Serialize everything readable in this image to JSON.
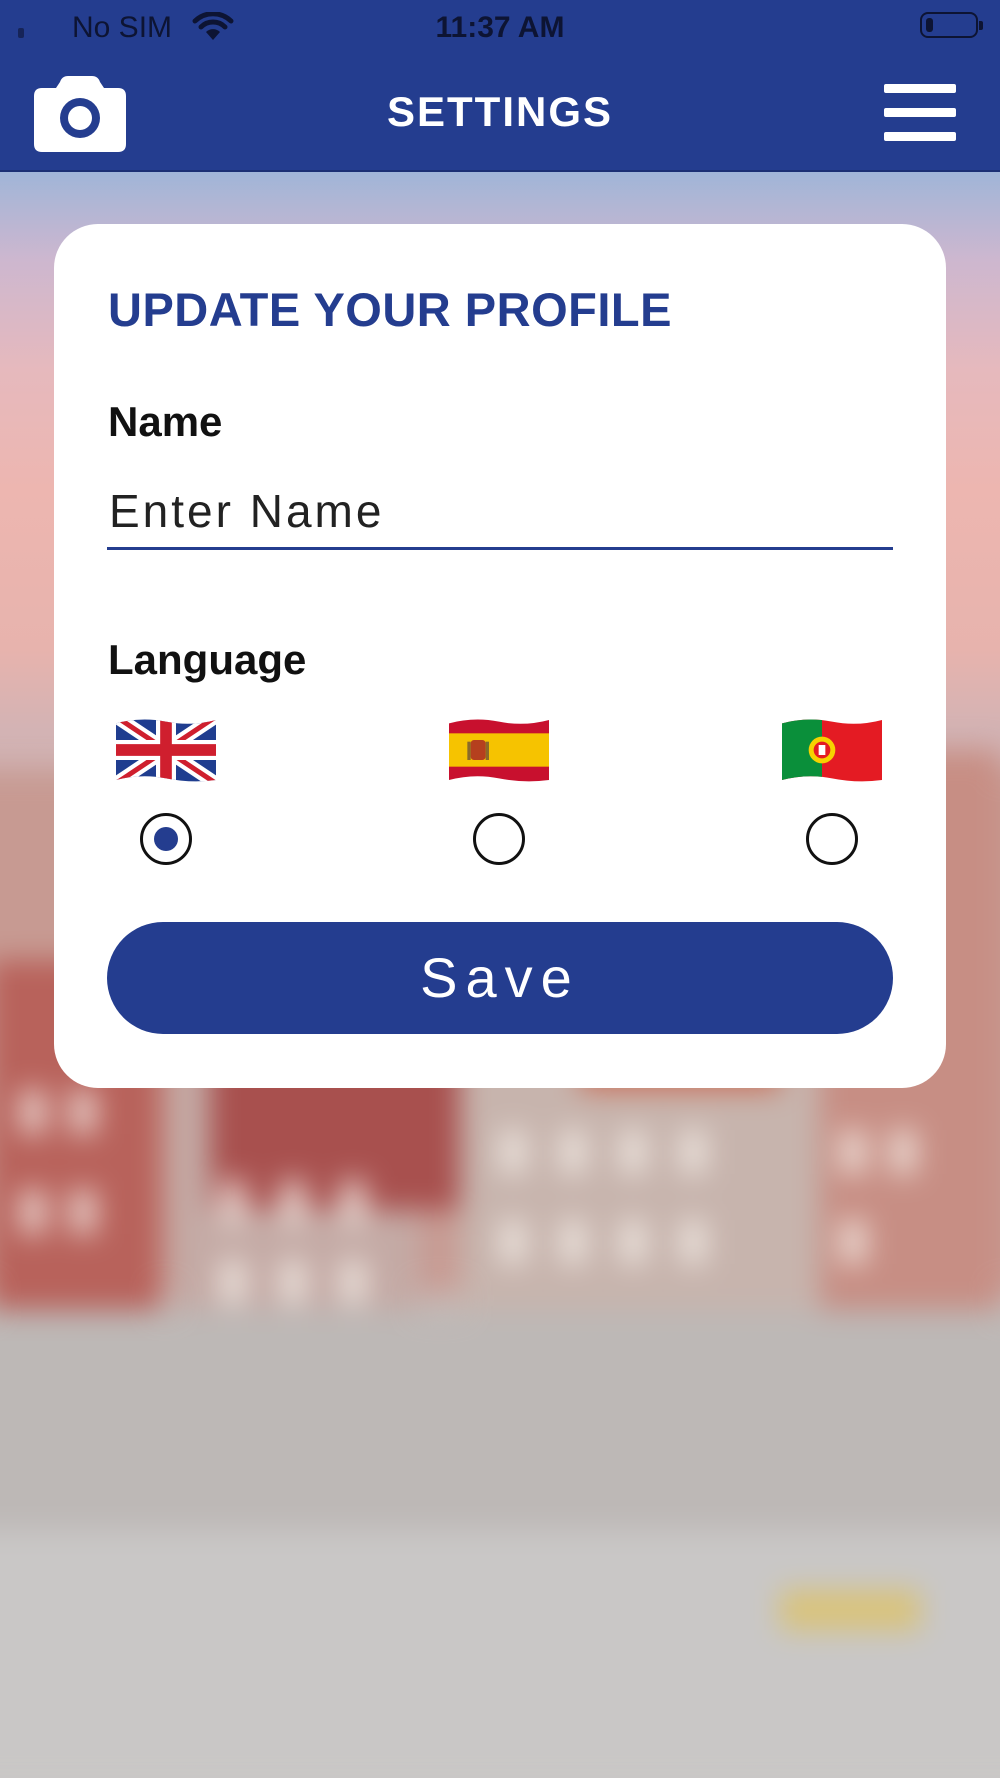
{
  "status_bar": {
    "carrier": "No SIM",
    "time": "11:37 AM",
    "battery_level": 0.15
  },
  "nav": {
    "title": "SETTINGS",
    "left_icon": "camera-icon",
    "right_icon": "menu-icon"
  },
  "profile": {
    "title": "UPDATE YOUR PROFILE",
    "name_label": "Name",
    "name_placeholder": "Enter Name",
    "name_value": "",
    "language_label": "Language",
    "languages": [
      {
        "flag": "uk-flag-icon",
        "selected": true
      },
      {
        "flag": "spain-flag-icon",
        "selected": false
      },
      {
        "flag": "portugal-flag-icon",
        "selected": false
      }
    ],
    "save_label": "Save"
  },
  "colors": {
    "brand": "#243d8f",
    "card": "#ffffff",
    "text": "#111111"
  }
}
